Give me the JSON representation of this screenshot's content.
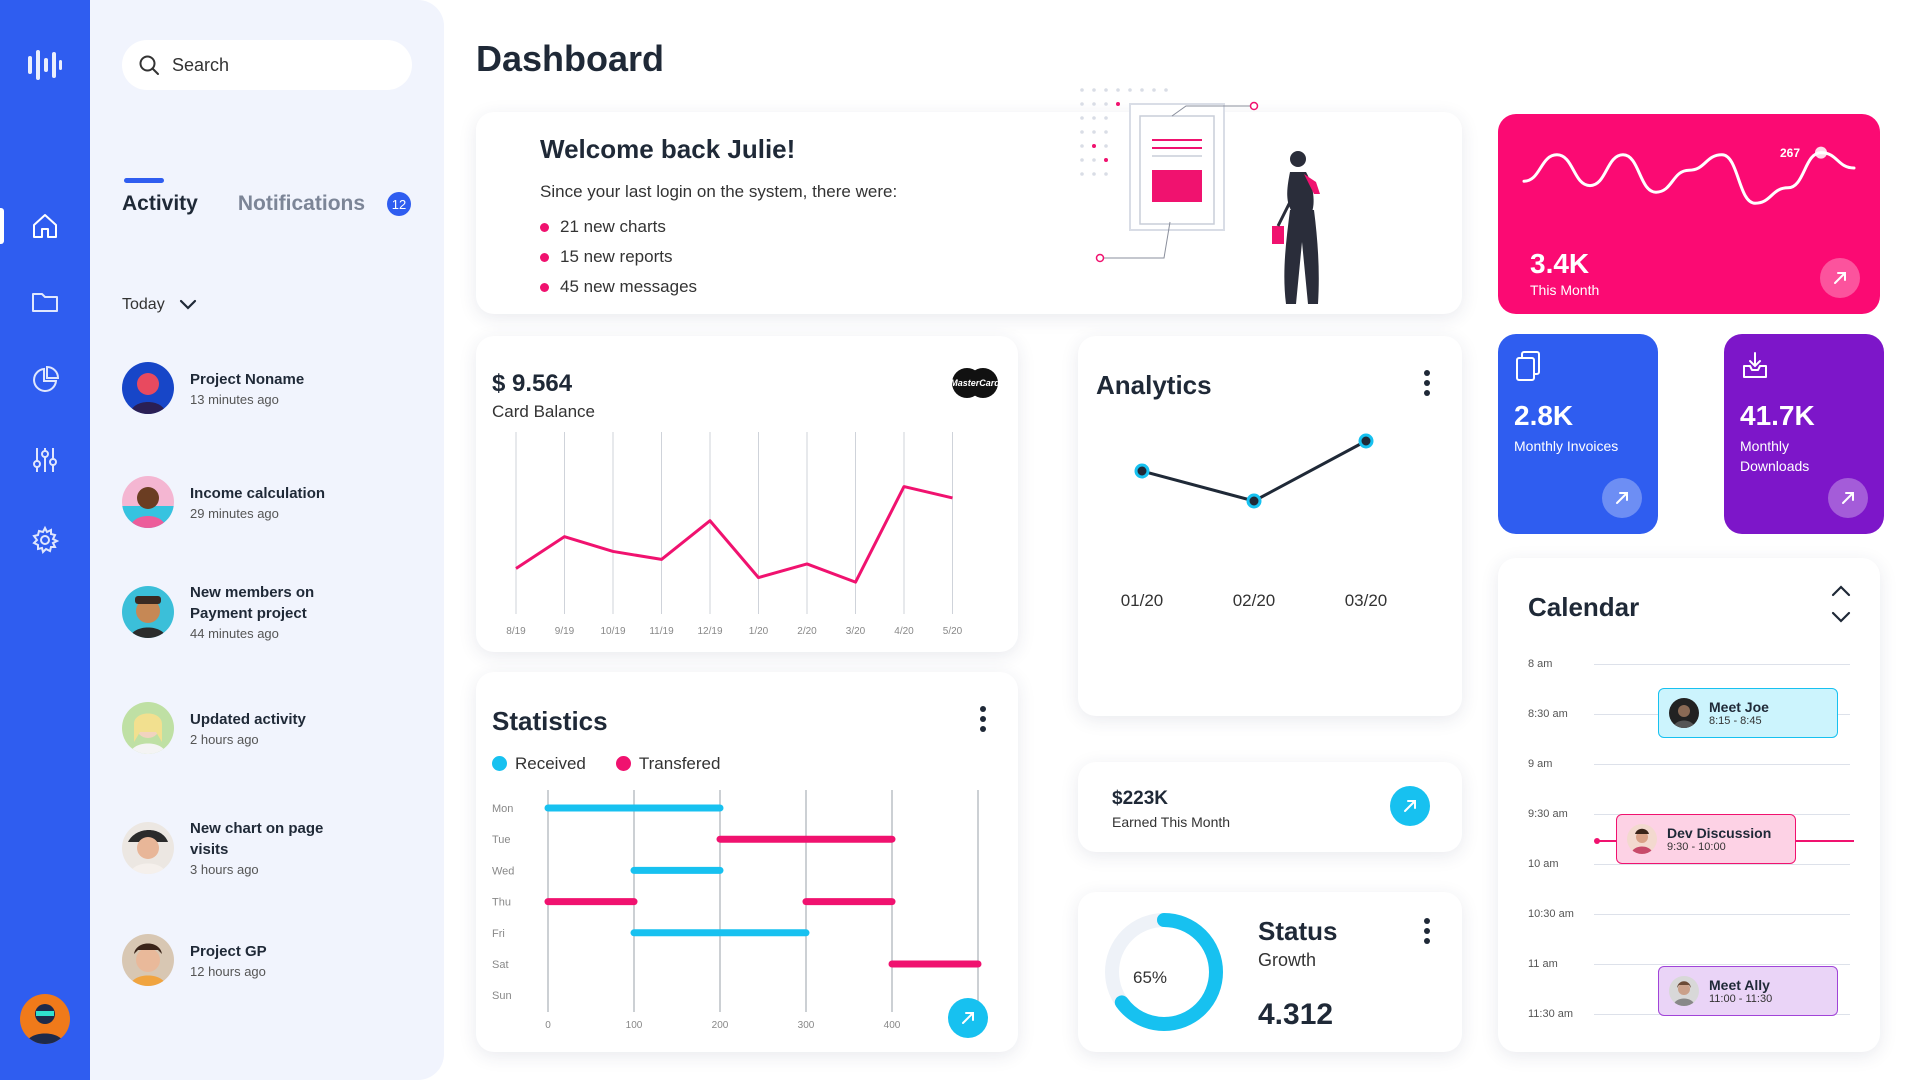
{
  "app": {
    "page_title": "Dashboard"
  },
  "search": {
    "placeholder": "Search"
  },
  "activity_panel": {
    "tabs": [
      {
        "label": "Activity"
      },
      {
        "label": "Notifications",
        "badge": "12"
      }
    ],
    "filter": "Today",
    "items": [
      {
        "title": "Project Noname",
        "time": "13 minutes ago"
      },
      {
        "title": "Income calculation",
        "time": "29 minutes ago"
      },
      {
        "title": "New members on Payment project",
        "time": "44 minutes ago"
      },
      {
        "title": "Updated activity",
        "time": "2 hours ago"
      },
      {
        "title": "New chart on page visits",
        "time": "3 hours ago"
      },
      {
        "title": "Project GP",
        "time": "12 hours ago"
      }
    ]
  },
  "welcome": {
    "title": "Welcome back Julie!",
    "lead": "Since your last login on the system, there were:",
    "bullets": [
      "21 new charts",
      "15 new reports",
      "45 new messages"
    ]
  },
  "balance_card": {
    "amount": "$ 9.564",
    "label": "Card Balance",
    "card_brand": "MasterCard",
    "chart_data": {
      "type": "line",
      "categories": [
        "8/19",
        "9/19",
        "10/19",
        "11/19",
        "12/19",
        "1/20",
        "2/20",
        "3/20",
        "4/20",
        "5/20"
      ],
      "values": [
        4.0,
        6.8,
        5.5,
        4.8,
        8.2,
        3.2,
        4.4,
        2.8,
        11.2,
        10.2
      ],
      "ylim": [
        0,
        16
      ],
      "color": "#f0126f"
    }
  },
  "statistics": {
    "title": "Statistics",
    "legend": [
      {
        "label": "Received",
        "color": "#17c1f0"
      },
      {
        "label": "Transfered",
        "color": "#f0126f"
      }
    ],
    "chart_data": {
      "type": "bar",
      "orientation": "horizontal-range",
      "categories": [
        "Mon",
        "Tue",
        "Wed",
        "Thu",
        "Fri",
        "Sat",
        "Sun"
      ],
      "x_ticks": [
        0,
        100,
        200,
        300,
        400,
        500
      ],
      "xlim": [
        0,
        500
      ],
      "series": [
        {
          "name": "Received",
          "color": "#17c1f0",
          "ranges": [
            {
              "row": 0,
              "from": 0,
              "to": 200
            },
            {
              "row": 2,
              "from": 100,
              "to": 200
            },
            {
              "row": 4,
              "from": 100,
              "to": 300
            }
          ]
        },
        {
          "name": "Transfered",
          "color": "#f0126f",
          "ranges": [
            {
              "row": 1,
              "from": 200,
              "to": 400
            },
            {
              "row": 3,
              "from": 0,
              "to": 100
            },
            {
              "row": 3,
              "from": 300,
              "to": 400
            },
            {
              "row": 5,
              "from": 400,
              "to": 500
            }
          ]
        }
      ]
    }
  },
  "analytics": {
    "title": "Analytics",
    "chart_data": {
      "type": "line",
      "categories": [
        "01/20",
        "02/20",
        "03/20"
      ],
      "values": [
        55,
        45,
        65
      ],
      "ylim": [
        20,
        80
      ]
    }
  },
  "earned": {
    "amount": "$223K",
    "label": "Earned This Month"
  },
  "status": {
    "title": "Status",
    "subtitle": "Growth",
    "value": "4.312",
    "percent_label": "65%",
    "percent": 0.65
  },
  "this_month": {
    "value": "3.4K",
    "label": "This Month",
    "peak_label": "267",
    "chart_data": {
      "type": "line",
      "values": [
        48,
        72,
        44,
        72,
        38,
        58,
        72,
        28,
        42,
        74,
        60
      ],
      "ylim": [
        0,
        100
      ],
      "peak_index": 9
    }
  },
  "invoices": {
    "value": "2.8K",
    "label": "Monthly Invoices"
  },
  "downloads": {
    "value": "41.7K",
    "label": "Monthly Downloads"
  },
  "calendar": {
    "title": "Calendar",
    "times": [
      "8 am",
      "8:30 am",
      "9 am",
      "9:30 am",
      "10 am",
      "10:30 am",
      "11 am",
      "11:30 am"
    ],
    "events": [
      {
        "title": "Meet Joe",
        "time": "8:15 - 8:45"
      },
      {
        "title": "Dev Discussion",
        "time": "9:30 - 10:00"
      },
      {
        "title": "Meet Ally",
        "time": "11:00 - 11:30"
      }
    ]
  },
  "colors": {
    "primary": "#2f5df0",
    "accent_pink": "#f0126f",
    "accent_cyan": "#17c1f0",
    "violet": "#7d16c9",
    "panel": "#f1f4fd"
  }
}
